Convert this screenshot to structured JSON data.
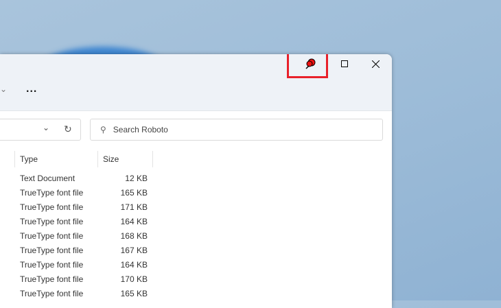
{
  "toolbar": {
    "more": "..."
  },
  "search": {
    "placeholder": "Search Roboto"
  },
  "columns": {
    "type": "Type",
    "size": "Size"
  },
  "rows": [
    {
      "type": "Text Document",
      "size": "12 KB"
    },
    {
      "type": "TrueType font file",
      "size": "165 KB"
    },
    {
      "type": "TrueType font file",
      "size": "171 KB"
    },
    {
      "type": "TrueType font file",
      "size": "164 KB"
    },
    {
      "type": "TrueType font file",
      "size": "168 KB"
    },
    {
      "type": "TrueType font file",
      "size": "167 KB"
    },
    {
      "type": "TrueType font file",
      "size": "164 KB"
    },
    {
      "type": "TrueType font file",
      "size": "170 KB"
    },
    {
      "type": "TrueType font file",
      "size": "165 KB"
    }
  ]
}
